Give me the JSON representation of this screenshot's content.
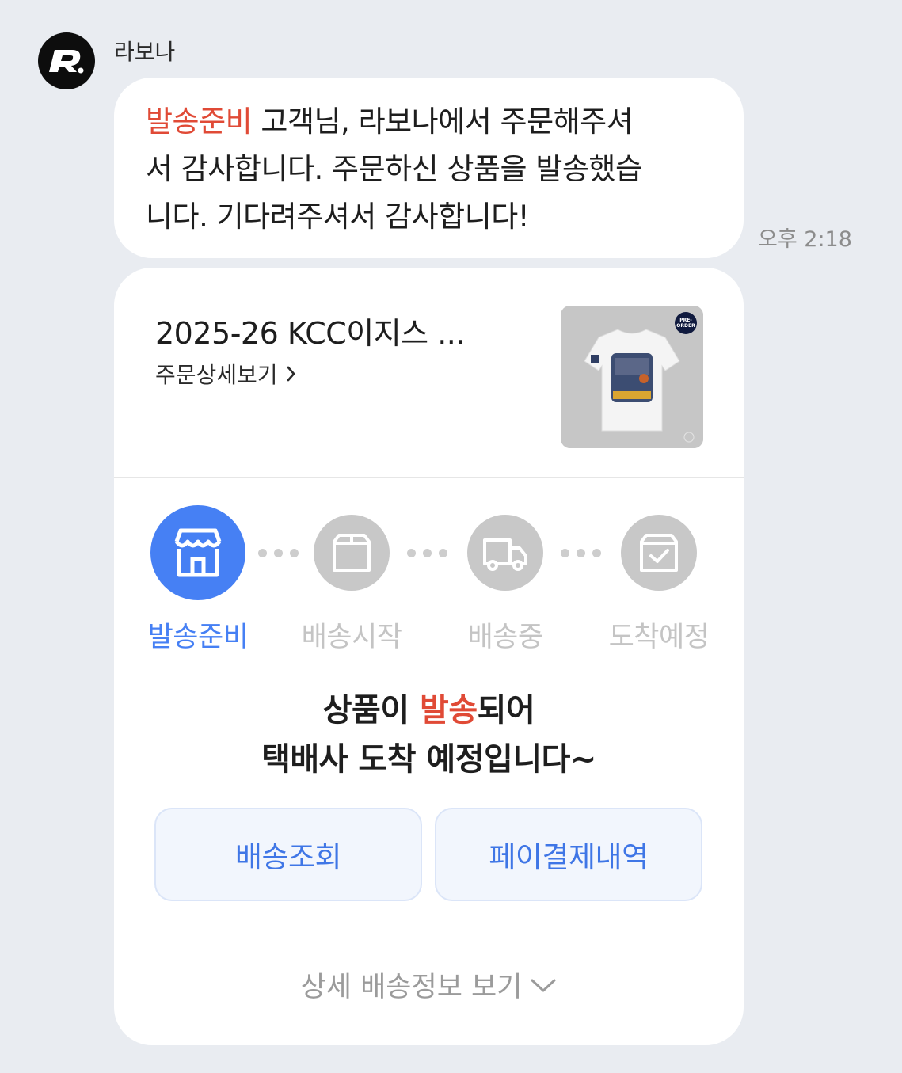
{
  "chat": {
    "sender_name": "라보나",
    "avatar_letter": "R",
    "time": "오후 2:18",
    "message": {
      "highlight": "발송준비",
      "line1_rest": " 고객님, 라보나에서 주문해주셔",
      "line2": "서 감사합니다. 주문하신 상품을 발송했습",
      "line3": "니다. 기다려주셔서 감사합니다!"
    }
  },
  "card": {
    "product_title": "2025-26 KCC이지스 ...",
    "detail_link": "주문상세보기",
    "product_badge_line1": "PRE-",
    "product_badge_line2": "ORDER",
    "steps": [
      {
        "label": "발송준비",
        "icon": "store-icon",
        "active": true
      },
      {
        "label": "배송시작",
        "icon": "box-icon",
        "active": false
      },
      {
        "label": "배송중",
        "icon": "truck-icon",
        "active": false
      },
      {
        "label": "도착예정",
        "icon": "box-check-icon",
        "active": false
      }
    ],
    "headline_pre": "상품이 ",
    "headline_highlight": "발송",
    "headline_post": "되어",
    "headline_line2": "택배사 도착 예정입니다~",
    "buttons": {
      "track": "배송조회",
      "pay_history": "페이결제내역"
    },
    "more_info": "상세 배송정보 보기"
  },
  "colors": {
    "accent_blue": "#4680f4",
    "highlight_red": "#e04a36",
    "inactive_gray": "#c8c8c8"
  }
}
